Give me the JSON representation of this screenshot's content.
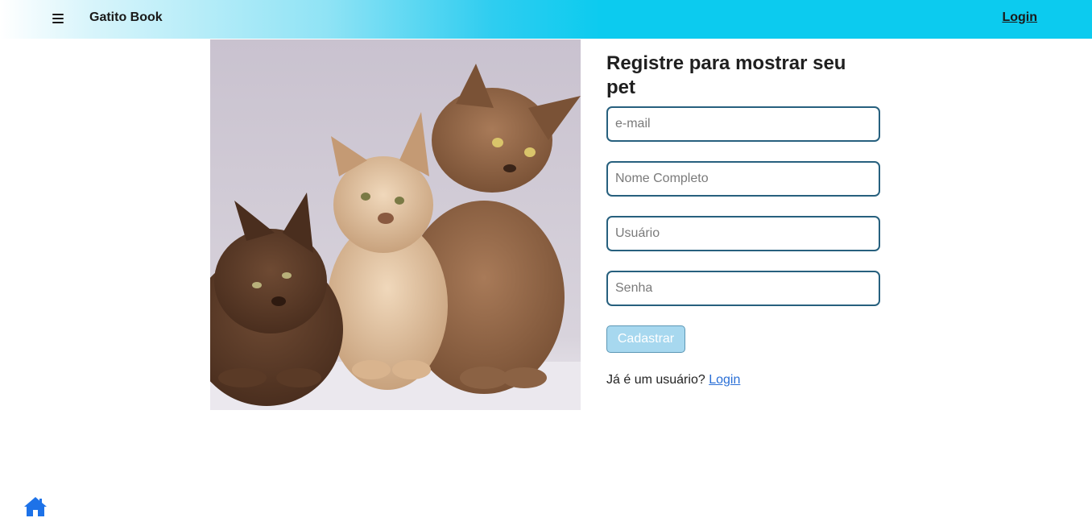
{
  "header": {
    "menu_icon": "hamburger-menu-icon",
    "brand": "Gatito Book",
    "login_label": "Login"
  },
  "photo": {
    "alt": "three kittens"
  },
  "form": {
    "title": "Registre para mostrar seu pet",
    "email_placeholder": "e-mail",
    "fullname_placeholder": "Nome Completo",
    "username_placeholder": "Usuário",
    "password_placeholder": "Senha",
    "submit_label": "Cadastrar",
    "already_text": "Já é um usuário?",
    "login_link": "Login"
  },
  "footer": {
    "home_icon": "home-icon"
  },
  "colors": {
    "header_accent": "#0ccbef",
    "field_border": "#27607e",
    "button_bg": "#a7d8ef",
    "link": "#2a6fd6",
    "home_icon": "#1d72e8"
  }
}
